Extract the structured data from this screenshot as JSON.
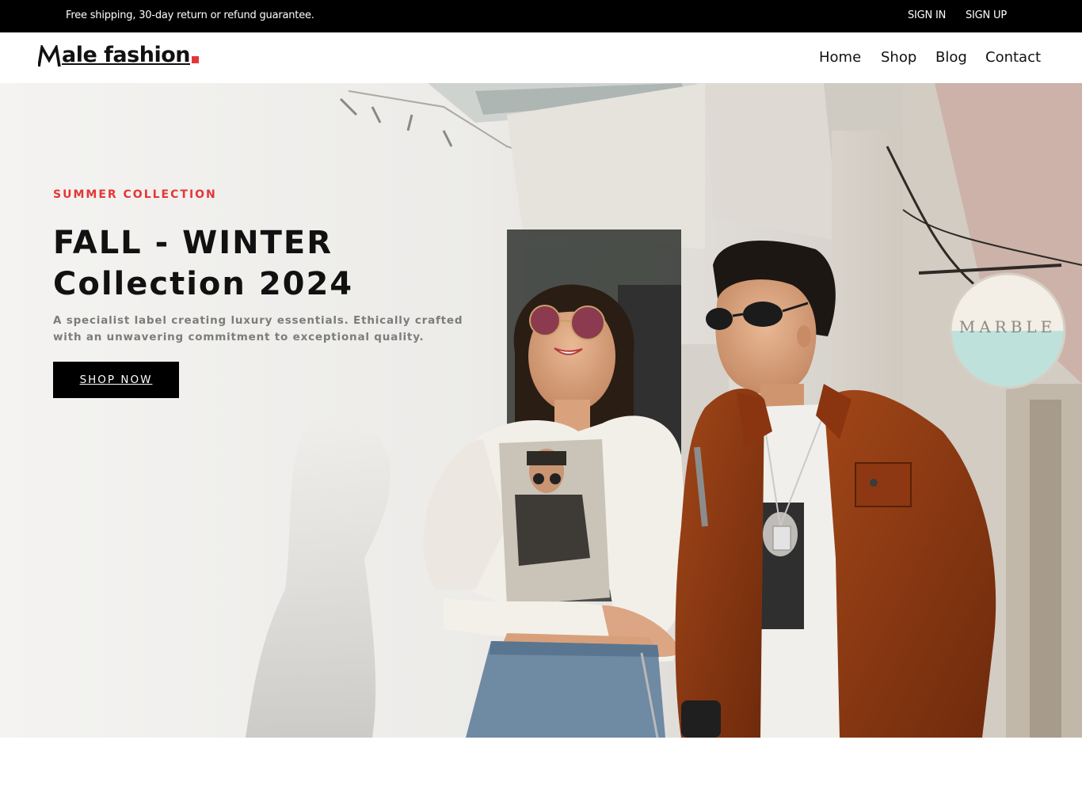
{
  "topbar": {
    "promo": "Free shipping, 30-day return or refund guarantee.",
    "sign_in": "SIGN IN",
    "sign_up": "SIGN UP"
  },
  "header": {
    "logo_text": "ale fashion",
    "nav": [
      "Home",
      "Shop",
      "Blog",
      "Contact"
    ]
  },
  "hero": {
    "eyebrow": "SUMMER COLLECTION",
    "headline_line1": "FALL - WINTER",
    "headline_line2": "Collection 2024",
    "tagline": "A specialist label creating luxury essentials. Ethically crafted with an unwavering commitment to exceptional quality.",
    "cta": "SHOP NOW",
    "sign_text": "MARBLE"
  },
  "colors": {
    "accent": "#e53637",
    "topbar_bg": "#000000",
    "text_dark": "#111111",
    "text_muted": "#7c7c7c"
  }
}
